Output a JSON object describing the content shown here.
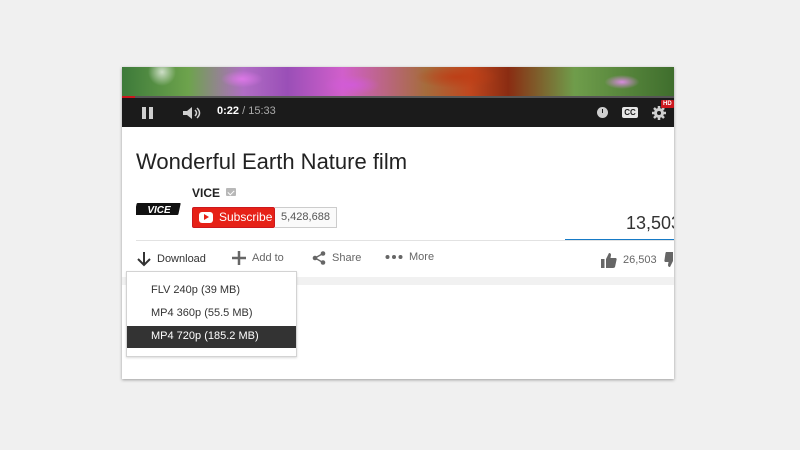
{
  "video": {
    "current_time": "0:22",
    "separator": "/",
    "duration": "15:33",
    "progress_fraction": 0.024,
    "cc_label": "CC",
    "hd_badge": "HD"
  },
  "info": {
    "title": "Wonderful Earth Nature film",
    "channel_name": "VICE",
    "subscribe_label": "Subscribe",
    "subscriber_count": "5,428,688",
    "view_count": "13,503"
  },
  "actions": {
    "download": "Download",
    "add_to": "Add to",
    "share": "Share",
    "more": "More",
    "like_count": "26,503"
  },
  "download_menu": {
    "options": [
      "FLV 240p (39 MB)",
      "MP4 360p (55.5 MB)",
      "MP4 720p (185.2 MB)"
    ],
    "selected_index": 2
  },
  "colors": {
    "subscribe_red": "#e62117",
    "view_bar_blue": "#167ac6",
    "player_bar": "#1b1b1b",
    "selected_option_bg": "#333333"
  }
}
